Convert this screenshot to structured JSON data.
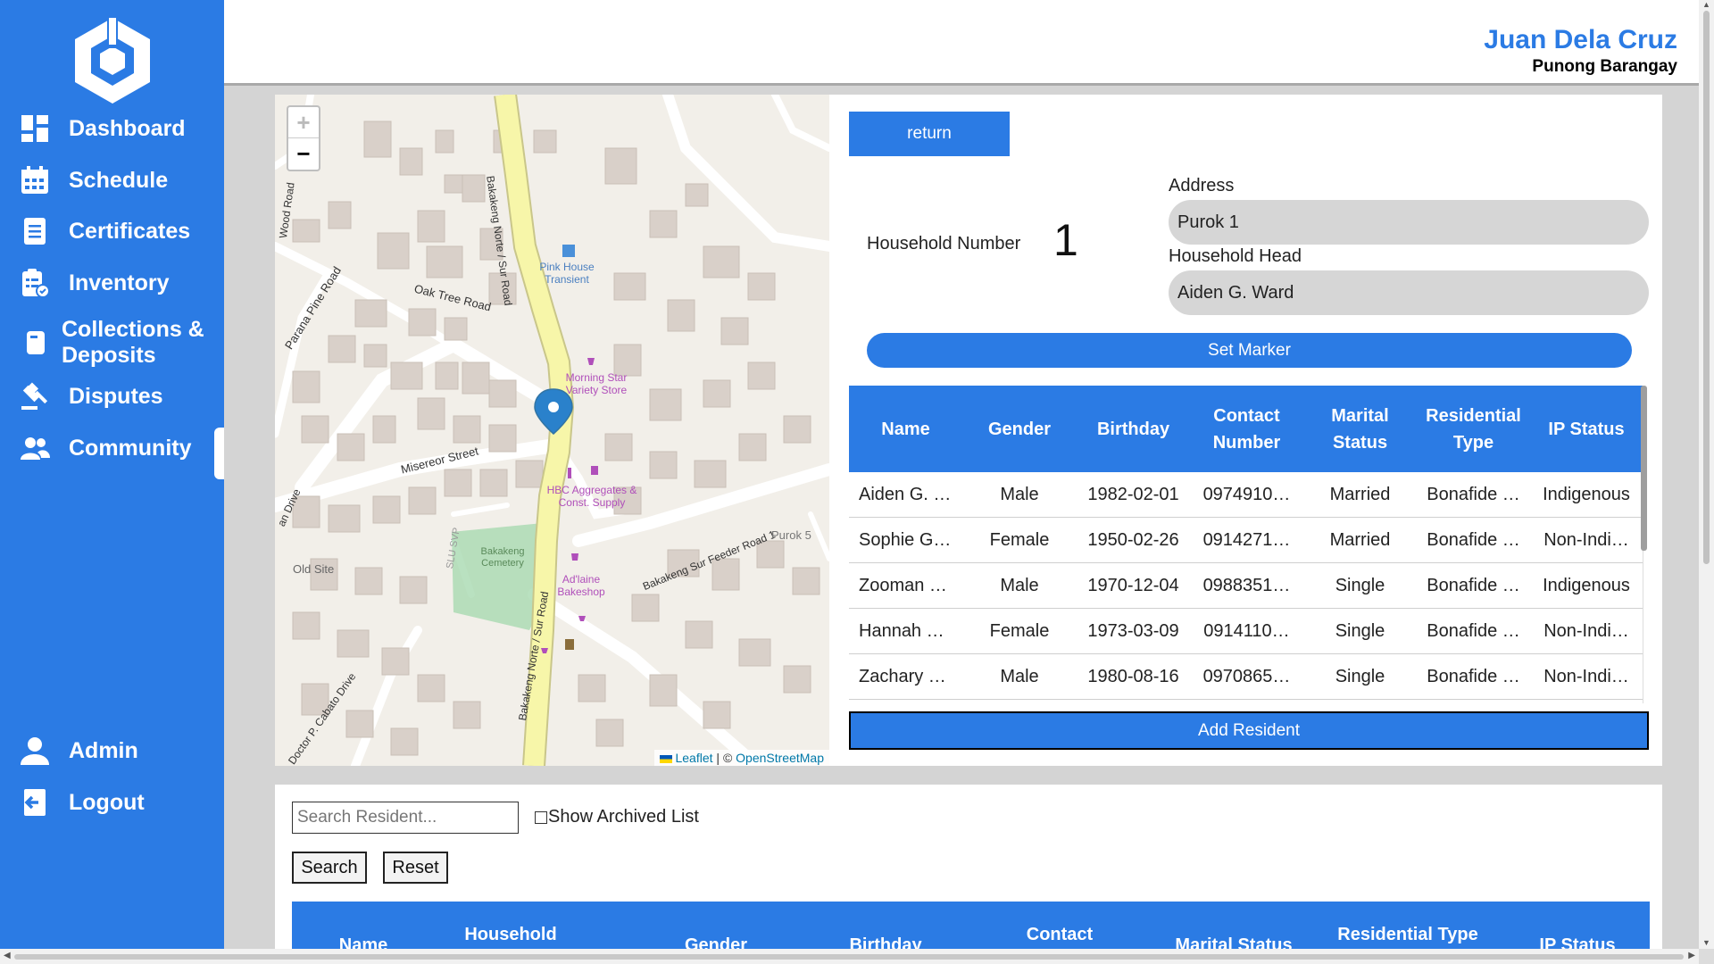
{
  "sidebar": {
    "items": [
      {
        "label": "Dashboard",
        "icon": "dashboard-icon"
      },
      {
        "label": "Schedule",
        "icon": "calendar-icon"
      },
      {
        "label": "Certificates",
        "icon": "document-icon"
      },
      {
        "label": "Inventory",
        "icon": "inventory-icon"
      },
      {
        "label": "Collections &",
        "label2": "Deposits",
        "icon": "wallet-icon"
      },
      {
        "label": "Disputes",
        "icon": "gavel-icon"
      },
      {
        "label": "Community",
        "icon": "people-icon"
      }
    ],
    "bottom_items": [
      {
        "label": "Admin",
        "icon": "user-icon"
      },
      {
        "label": "Logout",
        "icon": "logout-icon"
      }
    ],
    "active": "Community",
    "color": "#2b7be4"
  },
  "header": {
    "user_name": "Juan Dela Cruz",
    "user_role": "Punong Barangay"
  },
  "map": {
    "zoom_in": "+",
    "zoom_out": "−",
    "attribution": {
      "leaflet": "Leaflet",
      "sep": "| ©",
      "osm": "OpenStreetMap"
    },
    "labels": {
      "road1": "Bakakeng Norte / Sur Road",
      "road2": "Bakakeng Norte / Sur Road",
      "oak": "Oak Tree Road",
      "misereor": "Misereor Street",
      "parana": "Parana Pine Road",
      "wood": "Wood Road",
      "feeder": "Bakakeng Sur Feeder Road 1",
      "purok5": "Purok 5",
      "oldsite": "Old Site",
      "cemetery": "Bakakeng Cemetery",
      "slu": "SLU SVP",
      "cabato": "Doctor P. Cabato Drive",
      "drive": "an Drive",
      "road_left": "Road",
      "pink_house": "Pink House Transient",
      "morning_star": "Morning Star Variety Store",
      "hbc": "HBC Aggregates & Const. Supply",
      "adlaine": "Ad'laine Bakeshop"
    }
  },
  "form": {
    "return_label": "return",
    "household_number_label": "Household Number",
    "household_number": "1",
    "address_label": "Address",
    "address_value": "Purok 1",
    "head_label": "Household Head",
    "head_value": "Aiden G. Ward",
    "set_marker_label": "Set Marker",
    "add_resident_label": "Add Resident"
  },
  "residents_table": {
    "headers": [
      "Name",
      "Gender",
      "Birthday",
      "Contact Number",
      "Marital Status",
      "Residential Type",
      "IP Status"
    ],
    "rows": [
      [
        "Aiden G. …",
        "Male",
        "1982-02-01",
        "0974910…",
        "Married",
        "Bonafide …",
        "Indigenous"
      ],
      [
        "Sophie G…",
        "Female",
        "1950-02-26",
        "0914271…",
        "Married",
        "Bonafide …",
        "Non-Indi…"
      ],
      [
        "Zooman …",
        "Male",
        "1970-12-04",
        "0988351…",
        "Single",
        "Bonafide …",
        "Indigenous"
      ],
      [
        "Hannah …",
        "Female",
        "1973-03-09",
        "0914110…",
        "Single",
        "Bonafide …",
        "Non-Indi…"
      ],
      [
        "Zachary …",
        "Male",
        "1980-08-16",
        "0970865…",
        "Single",
        "Bonafide …",
        "Non-Indi…"
      ]
    ]
  },
  "search": {
    "placeholder": "Search Resident...",
    "archived_label": "Show Archived List",
    "search_label": "Search",
    "reset_label": "Reset"
  },
  "list_table": {
    "headers": [
      "Name",
      "Household Number",
      "Gender",
      "Birthday",
      "Contact Number",
      "Marital Status",
      "Residential Type",
      "IP Status"
    ]
  }
}
